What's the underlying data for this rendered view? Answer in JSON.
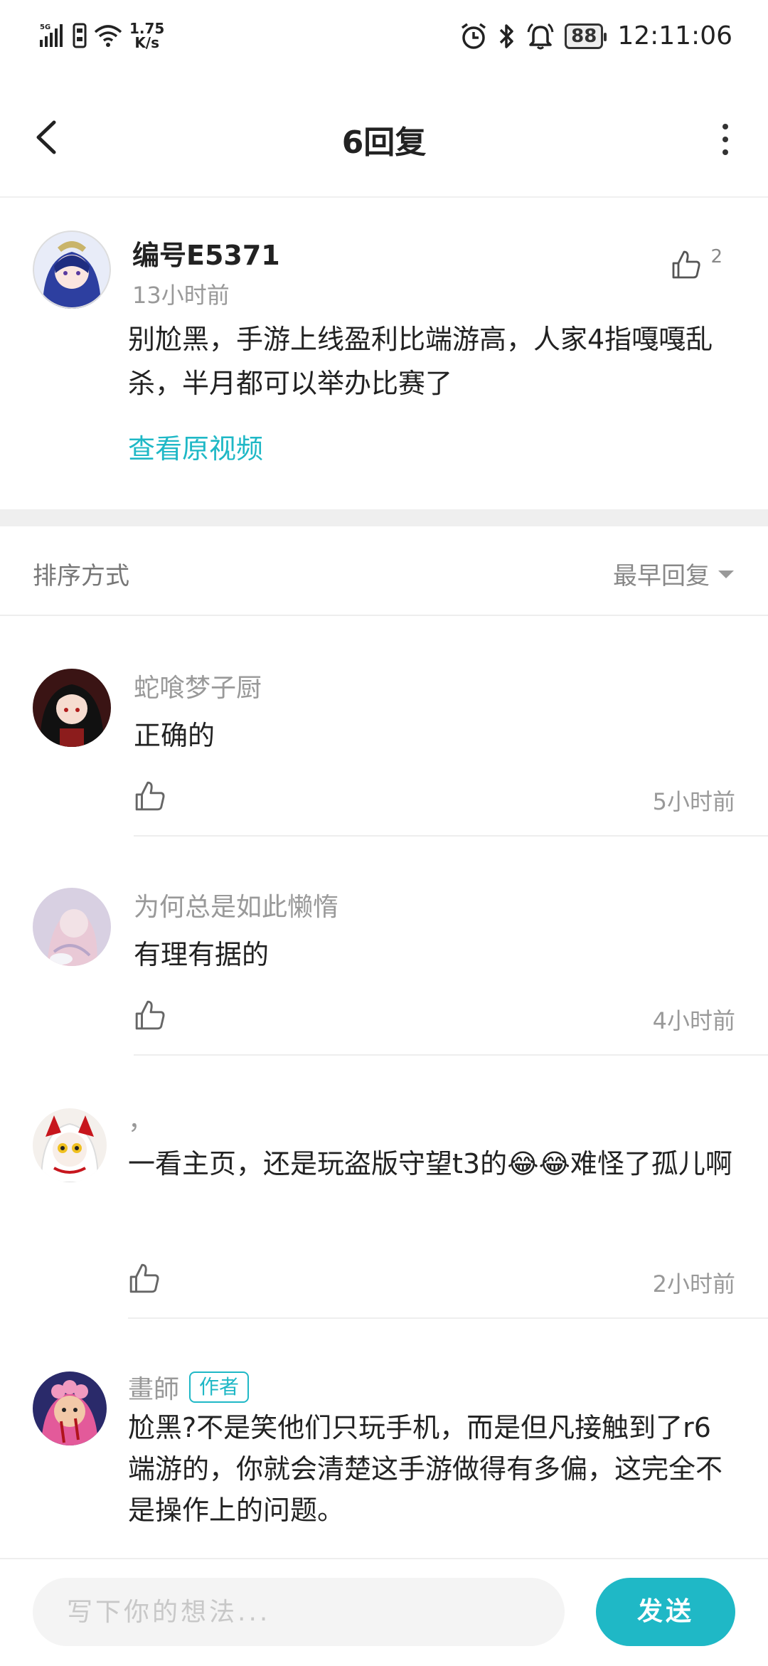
{
  "status_bar": {
    "network": "5G",
    "speed_value": "1.75",
    "speed_unit": "K/s",
    "battery": "88",
    "time": "12:11:06"
  },
  "header": {
    "title": "6回复"
  },
  "post": {
    "username": "编号E5371",
    "time": "13小时前",
    "like_count": "2",
    "body": "别尬黑，手游上线盈利比端游高，人家4指嘎嘎乱杀，半月都可以举办比赛了",
    "view_video": "查看原视频"
  },
  "sort": {
    "label": "排序方式",
    "selected": "最早回复"
  },
  "replies": [
    {
      "name": "蛇喰梦子厨",
      "text": "正确的",
      "time": "5小时前"
    },
    {
      "name": "为何总是如此懒惰",
      "text": "有理有据的",
      "time": "4小时前"
    },
    {
      "name": "，",
      "text": "一看主页，还是玩盗版守望t3的😂😂难怪了孤儿啊",
      "time": "2小时前"
    },
    {
      "name": "畫師",
      "badge": "作者",
      "text": "尬黑?不是笑他们只玩手机，而是但凡接触到了r6端游的，你就会清楚这手游做得有多偏，这完全不是操作上的问题。"
    }
  ],
  "comment": {
    "placeholder": "写下你的想法...",
    "send": "发送"
  },
  "colors": {
    "accent": "#1fb8c6",
    "muted_text": "#999999",
    "divider": "#efefef"
  },
  "icons": [
    "signal-icon",
    "sim-icon",
    "wifi-icon",
    "alarm-icon",
    "bluetooth-icon",
    "bell-icon",
    "battery-icon",
    "back-arrow-icon",
    "more-vertical-icon",
    "thumbs-up-icon",
    "dropdown-triangle-icon"
  ]
}
